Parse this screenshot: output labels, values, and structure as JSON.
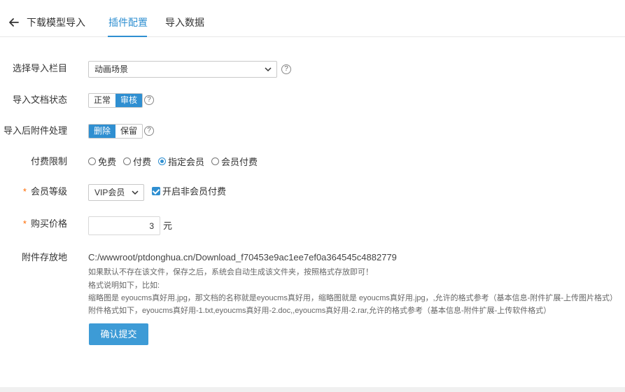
{
  "header": {
    "title": "下载模型导入",
    "tabs": [
      {
        "label": "插件配置",
        "active": true
      },
      {
        "label": "导入数据",
        "active": false
      }
    ],
    "accent": "#2f8fd1"
  },
  "form": {
    "column": {
      "label": "选择导入栏目",
      "value": "动画场景",
      "help": "?"
    },
    "doc_status": {
      "label": "导入文档状态",
      "options": [
        "正常",
        "审核"
      ],
      "selected": "审核",
      "help": "?"
    },
    "attachment": {
      "label": "导入后附件处理",
      "options": [
        "删除",
        "保留"
      ],
      "selected": "删除",
      "help": "?"
    },
    "pay_limit": {
      "label": "付费限制",
      "options": [
        "免费",
        "付费",
        "指定会员",
        "会员付费"
      ],
      "selected": "指定会员"
    },
    "member_level": {
      "required": "*",
      "label": "会员等级",
      "value": "VIP会员",
      "checkbox_label": "开启非会员付费",
      "checked": true
    },
    "price": {
      "required": "*",
      "label": "购买价格",
      "value": "3",
      "unit": "元"
    },
    "storage": {
      "label": "附件存放地",
      "path": "C:/wwwroot/ptdonghua.cn/Download_f70453e9ac1ee7ef0a364545c4882779",
      "notes": [
        "如果默认不存在该文件，保存之后，系统会自动生成该文件夹，按照格式存放即可！",
        "格式说明如下，比如:",
        "缩略图是 eyoucms真好用.jpg，那文档的名称就是eyoucms真好用，缩略图就是 eyoucms真好用.jpg，,允许的格式参考（基本信息-附件扩展-上传图片格式）",
        "附件格式如下，eyoucms真好用-1.txt,eyoucms真好用-2.doc,,eyoucms真好用-2.rar,允许的格式参考（基本信息-附件扩展-上传软件格式）"
      ]
    },
    "submit_label": "确认提交"
  }
}
